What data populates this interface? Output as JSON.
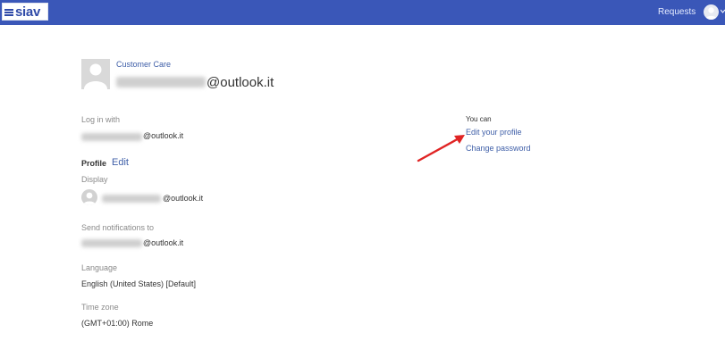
{
  "colors": {
    "topbar": "#3a57b8",
    "link": "#3f5fa8",
    "arrow": "#e02424"
  },
  "header": {
    "logo_text": "siav",
    "requests_label": "Requests",
    "avatar_icon": "user-avatar-icon",
    "caret_icon": "chevron-down-icon"
  },
  "profile": {
    "org_name": "Customer Care",
    "email_domain": "@outlook.it"
  },
  "login": {
    "label": "Log in with",
    "email_domain": "@outlook.it"
  },
  "section": {
    "title": "Profile",
    "edit_link": "Edit"
  },
  "display": {
    "label": "Display",
    "email_domain": "@outlook.it"
  },
  "notifications": {
    "label": "Send notifications to",
    "email_domain": "@outlook.it"
  },
  "language": {
    "label": "Language",
    "value": "English (United States) [Default]"
  },
  "timezone": {
    "label": "Time zone",
    "value": "(GMT+01:00) Rome"
  },
  "side": {
    "heading": "You can",
    "edit_profile": "Edit your profile",
    "change_password": "Change password"
  }
}
